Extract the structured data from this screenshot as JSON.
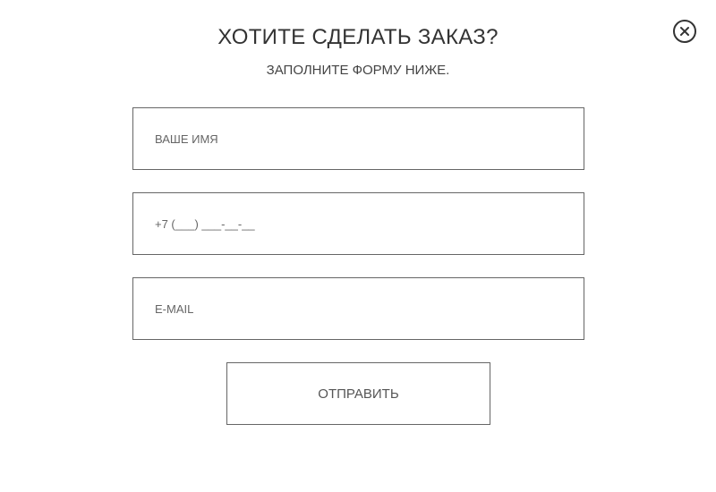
{
  "modal": {
    "title": "ХОТИТЕ СДЕЛАТЬ ЗАКАЗ?",
    "subtitle": "ЗАПОЛНИТЕ ФОРМУ НИЖЕ.",
    "close_icon": "close-circle-icon"
  },
  "form": {
    "name": {
      "value": "",
      "placeholder": "ВАШЕ ИМЯ"
    },
    "phone": {
      "value": "",
      "placeholder": "+7 (___) ___-__-__"
    },
    "email": {
      "value": "",
      "placeholder": "E-MAIL"
    },
    "submit_label": "ОТПРАВИТЬ"
  },
  "colors": {
    "background": "#ffffff",
    "text": "#333333",
    "border": "#666666"
  }
}
